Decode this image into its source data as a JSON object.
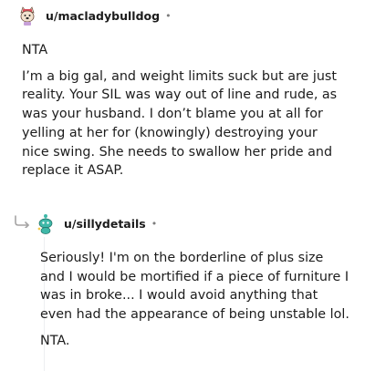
{
  "comments": [
    {
      "username": "u/macladybulldog",
      "separator": "•",
      "avatar_icon": "bulldog-avatar-icon",
      "paragraphs": [
        "NTA",
        "I’m a big gal, and weight limits suck but are just reality. Your SIL was way out of line and rude, as was your husband. I don’t blame you at all for yelling at her for (knowingly) destroying your nice swing. She needs to swallow her pride and replace it ASAP."
      ]
    },
    {
      "username": "u/sillydetails",
      "separator": "•",
      "avatar_icon": "snoo-avatar-icon",
      "reply_icon": "reply-arrow-icon",
      "paragraphs": [
        "Seriously! I'm on the borderline of plus size and I would be mortified if a piece of furniture I was in broke... I would avoid anything that even had the appearance of being unstable lol.",
        "NTA."
      ]
    }
  ],
  "colors": {
    "text": "#1c1c1c",
    "meta": "#7c7c7c",
    "thread_line": "#edeff1",
    "avatar2_accent": "#3fb8a8"
  }
}
